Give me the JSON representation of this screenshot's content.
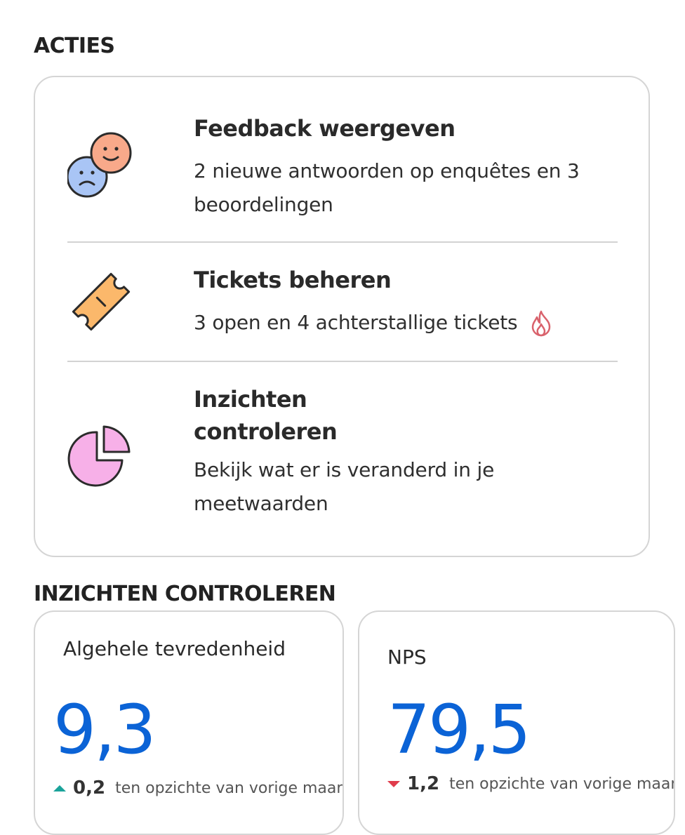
{
  "actions_section": {
    "title": "ACTIES",
    "items": [
      {
        "icon": "smiley-faces-icon",
        "title": "Feedback weergeven",
        "description": "2 nieuwe antwoorden op enquêtes en 3 beoordelingen"
      },
      {
        "icon": "ticket-icon",
        "title": "Tickets beheren",
        "description": "3 open en 4 achterstallige tickets",
        "badge_icon": "fire-icon"
      },
      {
        "icon": "pie-chart-icon",
        "title": "Inzichten controleren",
        "description": "Bekijk wat er is veranderd in je meetwaarden"
      }
    ]
  },
  "insights_section": {
    "title": "INZICHTEN CONTROLEREN",
    "metrics": [
      {
        "label": "Algehele tevredenheid",
        "value": "9,3",
        "change": "0,2",
        "direction": "up",
        "change_text": "ten opzichte van vorige maand"
      },
      {
        "label": "NPS",
        "value": "79,5",
        "change": "1,2",
        "direction": "down",
        "change_text": "ten opzichte van vorige maand"
      }
    ]
  },
  "colors": {
    "accent_blue": "#0b63d6",
    "trend_up": "#1aa39a",
    "trend_down": "#e03c4c",
    "border": "#d5d5d5"
  }
}
